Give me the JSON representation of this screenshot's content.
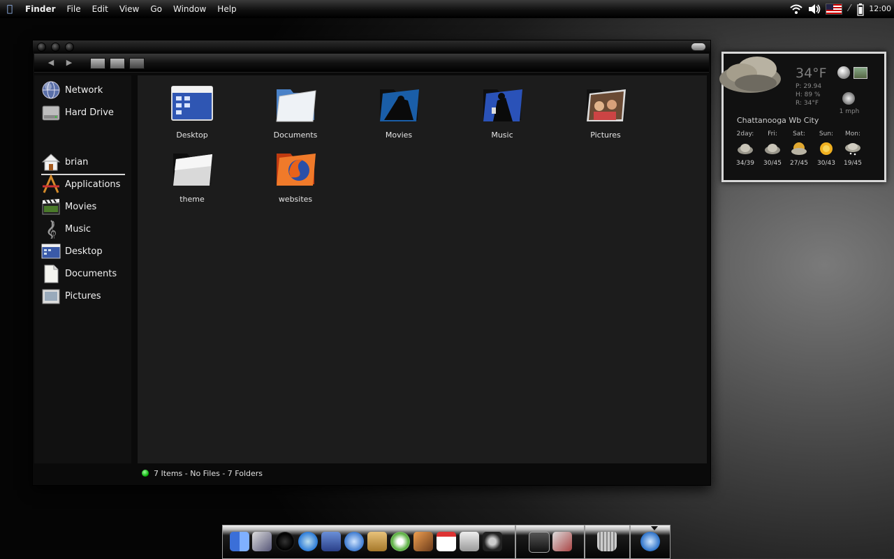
{
  "menubar": {
    "app_name": "Finder",
    "menus": [
      "File",
      "Edit",
      "View",
      "Go",
      "Window",
      "Help"
    ],
    "clock": "12:00",
    "tray_icons": [
      "wifi-icon",
      "volume-icon",
      "us-flag-icon",
      "bluetooth-icon",
      "battery-icon"
    ]
  },
  "finder": {
    "sidebar": {
      "devices": [
        {
          "label": "Network",
          "icon": "network-globe-icon"
        },
        {
          "label": "Hard Drive",
          "icon": "hard-drive-icon"
        }
      ],
      "places": [
        {
          "label": "brian",
          "icon": "home-icon"
        },
        {
          "label": "Applications",
          "icon": "applications-icon"
        },
        {
          "label": "Movies",
          "icon": "movies-clapper-icon"
        },
        {
          "label": "Music",
          "icon": "music-clef-icon"
        },
        {
          "label": "Desktop",
          "icon": "desktop-icon"
        },
        {
          "label": "Documents",
          "icon": "document-icon"
        },
        {
          "label": "Pictures",
          "icon": "pictures-icon"
        }
      ]
    },
    "items": [
      {
        "label": "Desktop",
        "icon": "desktop-folder-icon"
      },
      {
        "label": "Documents",
        "icon": "documents-folder-icon"
      },
      {
        "label": "Movies",
        "icon": "movies-folder-icon"
      },
      {
        "label": "Music",
        "icon": "music-folder-icon"
      },
      {
        "label": "Pictures",
        "icon": "pictures-folder-icon"
      },
      {
        "label": "theme",
        "icon": "folder-icon"
      },
      {
        "label": "websites",
        "icon": "firefox-folder-icon"
      }
    ],
    "status": "7 Items - No Files - 7 Folders"
  },
  "weather": {
    "temperature": "34°F",
    "pressure": "P:  29.94",
    "humidity": "H:  89 %",
    "realfeel": "R:  34°F",
    "wind": "1 mph",
    "city": "Chattanooga Wb City",
    "forecast": [
      {
        "day": "2day:",
        "range": "34/39",
        "icon": "cloudy-icon"
      },
      {
        "day": "Fri:",
        "range": "30/45",
        "icon": "cloudy-icon"
      },
      {
        "day": "Sat:",
        "range": "27/45",
        "icon": "partly-sunny-icon"
      },
      {
        "day": "Sun:",
        "range": "30/43",
        "icon": "sunny-icon"
      },
      {
        "day": "Mon:",
        "range": "19/45",
        "icon": "snow-icon"
      }
    ]
  },
  "dock": {
    "apps": [
      "finder-icon",
      "preview-icon",
      "dashboard-icon",
      "safari-icon",
      "mail-stamp-icon",
      "ichat-icon",
      "address-book-icon",
      "itunes-icon",
      "iphoto-icon",
      "ical-icon",
      "system-icon",
      "gimp-icon"
    ],
    "extras": [
      "terminal-icon",
      "package-icon"
    ],
    "trash": "trash-icon",
    "kde": "kde-menu-icon"
  },
  "colors": {
    "accent_green": "#00aa00",
    "window_bg": "#1c1c1c",
    "sidebar_bg": "#111111"
  }
}
